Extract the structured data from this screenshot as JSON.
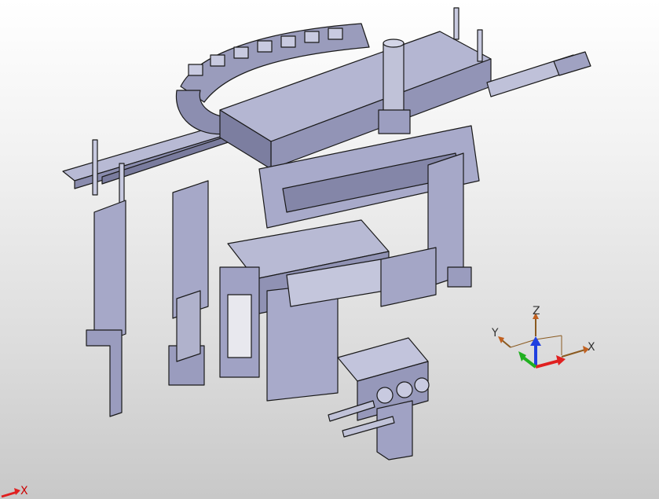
{
  "triad": {
    "x_label": "X",
    "y_label": "Y",
    "z_label": "Z"
  },
  "corner_axis": {
    "label": "X"
  },
  "colors": {
    "part_face": "#a6a8c8",
    "part_face_dark": "#8a8cae",
    "part_face_light": "#c4c6dc",
    "edge": "#1a1a1a",
    "axis_x": "#e02020",
    "axis_y": "#20b020",
    "axis_z": "#2040e0"
  }
}
